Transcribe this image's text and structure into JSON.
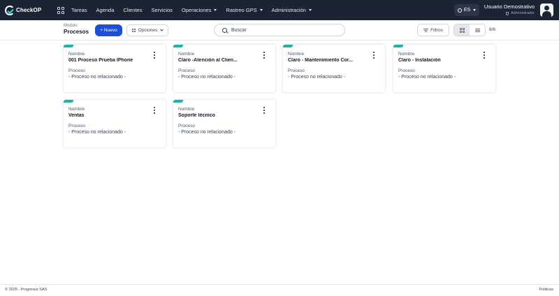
{
  "app": {
    "logo_text": "CheckOP"
  },
  "nav": {
    "items": [
      {
        "label": "Tareas",
        "dropdown": false
      },
      {
        "label": "Agenda",
        "dropdown": false
      },
      {
        "label": "Clientes",
        "dropdown": false
      },
      {
        "label": "Servicios",
        "dropdown": false
      },
      {
        "label": "Operaciones",
        "dropdown": true
      },
      {
        "label": "Rastreo GPS",
        "dropdown": true
      },
      {
        "label": "Administración",
        "dropdown": true
      }
    ]
  },
  "language": {
    "label": "ES"
  },
  "user": {
    "name": "Usuario Demostrativo",
    "role": "Administrador"
  },
  "toolbar": {
    "module_label": "Modulo",
    "module_title": "Procesos",
    "new_label": "+ Nuevo",
    "options_label": "Opciones",
    "search_placeholder": "Buscar",
    "filters_label": "Filtros",
    "count": "6/6"
  },
  "cards": [
    {
      "name_label": "Nombre",
      "name": "001 Proceso Prueba IPhone",
      "process_label": "Proceso",
      "process": "- Proceso no relacionado -"
    },
    {
      "name_label": "Nombre",
      "name": "Claro -Atención al Clien...",
      "process_label": "Proceso",
      "process": "- Proceso no relacionado -"
    },
    {
      "name_label": "Nombre",
      "name": "Claro - Mantenimiento Cor...",
      "process_label": "Proceso",
      "process": "- Proceso no relacionado -"
    },
    {
      "name_label": "Nombre",
      "name": "Claro - Instalación",
      "process_label": "Proceso",
      "process": "- Proceso no relacionado -"
    },
    {
      "name_label": "Nombre",
      "name": "Ventas",
      "process_label": "Proceso",
      "process": "- Proceso no relacionado -"
    },
    {
      "name_label": "Nombre",
      "name": "Soporte técnico",
      "process_label": "Proceso",
      "process": "- Proceso no relacionado -"
    }
  ],
  "footer": {
    "copyright": "© 2025 - Progresus SAS",
    "link": "Politicas"
  },
  "colors": {
    "topbar": "#1b2433",
    "accent": "#1bb5a6",
    "primary_button": "#1d4ed8"
  }
}
